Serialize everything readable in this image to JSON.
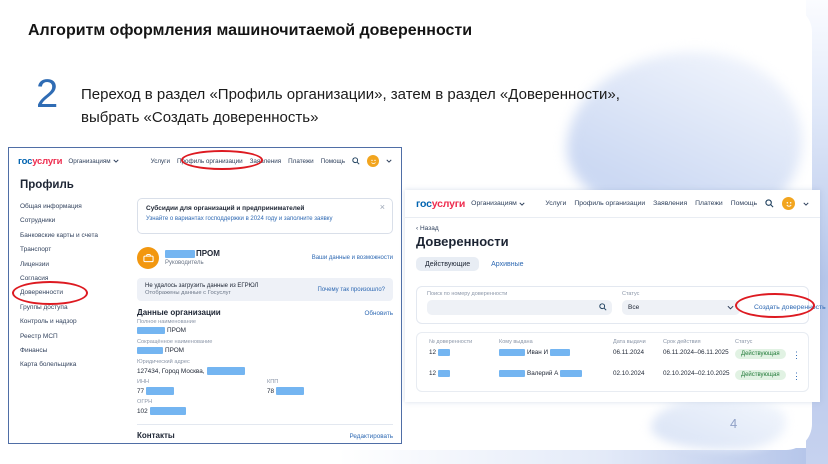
{
  "slide": {
    "title": "Алгоритм оформления машиночитаемой доверенности",
    "step_number": "2",
    "step_text_line1": "Переход в  раздел «Профиль организации», затем в раздел «Доверенности»,",
    "step_text_line2": "выбрать «Создать доверенность»",
    "page_number": "4"
  },
  "colors": {
    "annotation_red": "#dd1a21",
    "step_blue": "#2f6cb4",
    "logo_blue": "#0063b0",
    "logo_red": "#ee2d4f",
    "link_blue": "#2e69b3",
    "badge_bg": "#e1f2e3",
    "badge_text": "#217a38",
    "redaction_blue": "#74b5f1"
  },
  "icons": {
    "close_glyph": "×",
    "kebab_glyph": "⋮",
    "back_glyph": "‹"
  },
  "portal": {
    "logo_gos": "гос",
    "logo_uslugi": "услуги",
    "audience": "Организациям",
    "nav": [
      "Услуги",
      "Профиль организации",
      "Заявления",
      "Платежи",
      "Помощь"
    ]
  },
  "left_shot": {
    "page_title": "Профиль",
    "sidebar": [
      "Общая информация",
      "Сотрудники",
      "Банковские карты и счета",
      "Транспорт",
      "Лицензии",
      "Согласия",
      "Доверенности",
      "Группы доступа",
      "Контроль и надзор",
      "Реестр МСП",
      "Финансы",
      "Карта болельщика"
    ],
    "banner": {
      "title": "Субсидии для организаций и предпринимателей",
      "link": "Узнайте о вариантах господдержки в 2024 году и заполните заявку"
    },
    "org_card": {
      "name": "ПРОМ",
      "role": "Руководитель",
      "link": "Ваши данные и возможности"
    },
    "notice": {
      "line1": "Не удалось загрузить данные из ЕГРЮЛ",
      "line2": "Отображены данные с Госуслуг",
      "link": "Почему так произошло?"
    },
    "org_data": {
      "heading": "Данные организации",
      "refresh": "Обновить",
      "full_name_label": "Полное наименование",
      "full_name_value": "ПРОМ",
      "short_name_label": "Сокращённое наименование",
      "short_name_value": "ПРОМ",
      "address_label": "Юридический адрес",
      "address_value": "127434, Город Москва,",
      "inn_label": "ИНН",
      "inn_value": "77",
      "kpp_label": "КПП",
      "kpp_value": "78",
      "ogrn_label": "ОГРН",
      "ogrn_value": "102",
      "contacts_heading": "Контакты",
      "edit_link": "Редактировать"
    }
  },
  "right_shot": {
    "back": "Назад",
    "page_title": "Доверенности",
    "tabs": {
      "active": "Действующие",
      "archive": "Архивные"
    },
    "filter": {
      "search_label": "Поиск по номеру доверенности",
      "status_label": "Статус",
      "status_value": "Все",
      "create_label": "Создать доверенность"
    },
    "table": {
      "headers": [
        "№ доверенности",
        "Кому выдана",
        "Дата выдачи",
        "Срок действия",
        "Статус"
      ],
      "rows": [
        {
          "number": "12",
          "issued_to": "Иван И",
          "issue_date": "06.11.2024",
          "validity": "06.11.2024–06.11.2025",
          "status": "Действующая"
        },
        {
          "number": "12",
          "issued_to": "Валерий А",
          "issue_date": "02.10.2024",
          "validity": "02.10.2024–02.10.2025",
          "status": "Действующая"
        }
      ]
    }
  }
}
